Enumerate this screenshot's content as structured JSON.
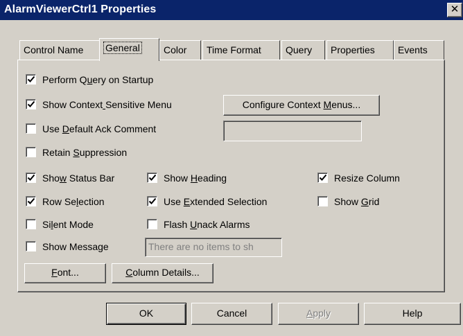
{
  "window": {
    "title": "AlarmViewerCtrl1 Properties",
    "close_glyph": "✕"
  },
  "tabs": [
    {
      "label": "Control Name",
      "active": false
    },
    {
      "label": "General",
      "active": true
    },
    {
      "label": "Color",
      "active": false
    },
    {
      "label": "Time Format",
      "active": false
    },
    {
      "label": "Query",
      "active": false
    },
    {
      "label": "Properties",
      "active": false
    },
    {
      "label": "Events",
      "active": false
    }
  ],
  "general": {
    "perform_query": {
      "label": "Perform Query on Startup",
      "checked": true
    },
    "context_menu": {
      "label": "Show Context Sensitive Menu",
      "checked": true
    },
    "configure_context_menus_button": "Configure Context Menus...",
    "default_ack": {
      "label": "Use Default Ack Comment",
      "checked": false
    },
    "default_ack_comment_value": "",
    "retain_suppression": {
      "label": "Retain Suppression",
      "checked": false
    },
    "status_bar": {
      "label": "Show Status Bar",
      "checked": true
    },
    "show_heading": {
      "label": "Show Heading",
      "checked": true
    },
    "resize_column": {
      "label": "Resize Column",
      "checked": true
    },
    "row_selection": {
      "label": "Row Selection",
      "checked": true
    },
    "extended_selection": {
      "label": "Use Extended Selection",
      "checked": true
    },
    "show_grid": {
      "label": "Show Grid",
      "checked": false
    },
    "silent_mode": {
      "label": "Silent Mode",
      "checked": false
    },
    "flash_unack": {
      "label": "Flash Unack Alarms",
      "checked": false
    },
    "show_message": {
      "label": "Show Message",
      "checked": false
    },
    "message_value": "There are no items to sh",
    "font_button": "Font...",
    "column_details_button": "Column Details..."
  },
  "footer": {
    "ok": "OK",
    "cancel": "Cancel",
    "apply": "Apply",
    "help": "Help"
  },
  "colors": {
    "title_bar": "#0a246a",
    "dialog_face": "#d4d0c8"
  }
}
